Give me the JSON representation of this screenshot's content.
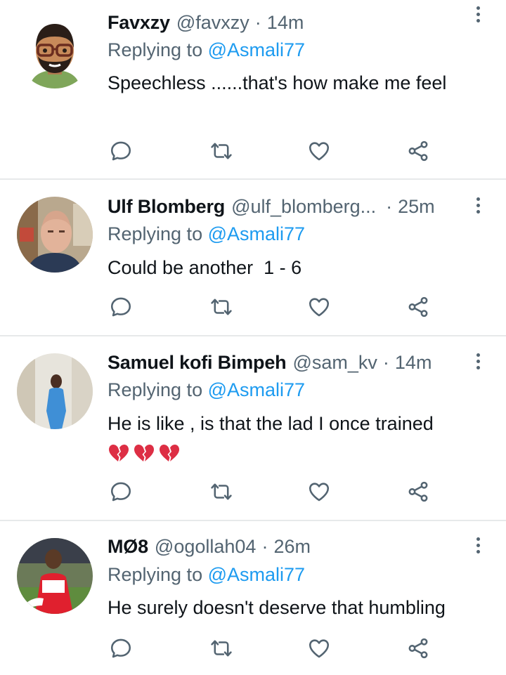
{
  "colors": {
    "muted": "#536471",
    "link": "#1d9bf0",
    "text": "#0f1419",
    "divider": "#e7e9ea"
  },
  "tweets": [
    {
      "name": "Favxzy",
      "handle": "@favxzy",
      "separator": "·",
      "time": "14m",
      "replying_prefix": "Replying to",
      "replying_to": "@Asmali77",
      "text": "Speechless ......that's how make me feel",
      "emojis": [],
      "avatar": "memoji-avatar"
    },
    {
      "name": "Ulf Blomberg",
      "handle": "@ulf_blomberg...",
      "separator": "·",
      "time": "25m",
      "replying_prefix": "Replying to",
      "replying_to": "@Asmali77",
      "text": "Could be another  1 - 6",
      "emojis": [],
      "avatar": "photo-avatar"
    },
    {
      "name": "Samuel kofi Bimpeh",
      "handle": "@sam_kv",
      "separator": "·",
      "time": "14m",
      "replying_prefix": "Replying to",
      "replying_to": "@Asmali77",
      "text": "He is like , is that the lad I once trained",
      "emojis": [
        "broken-heart-icon",
        "broken-heart-icon",
        "broken-heart-icon"
      ],
      "avatar": "photo-avatar"
    },
    {
      "name": "MØ8",
      "handle": "@ogollah04",
      "separator": "·",
      "time": "26m",
      "replying_prefix": "Replying to",
      "replying_to": "@Asmali77",
      "text": "He surely doesn't deserve that humbling",
      "emojis": [],
      "avatar": "photo-avatar"
    }
  ],
  "action_icons": [
    "reply-icon",
    "retweet-icon",
    "like-icon",
    "share-icon"
  ]
}
